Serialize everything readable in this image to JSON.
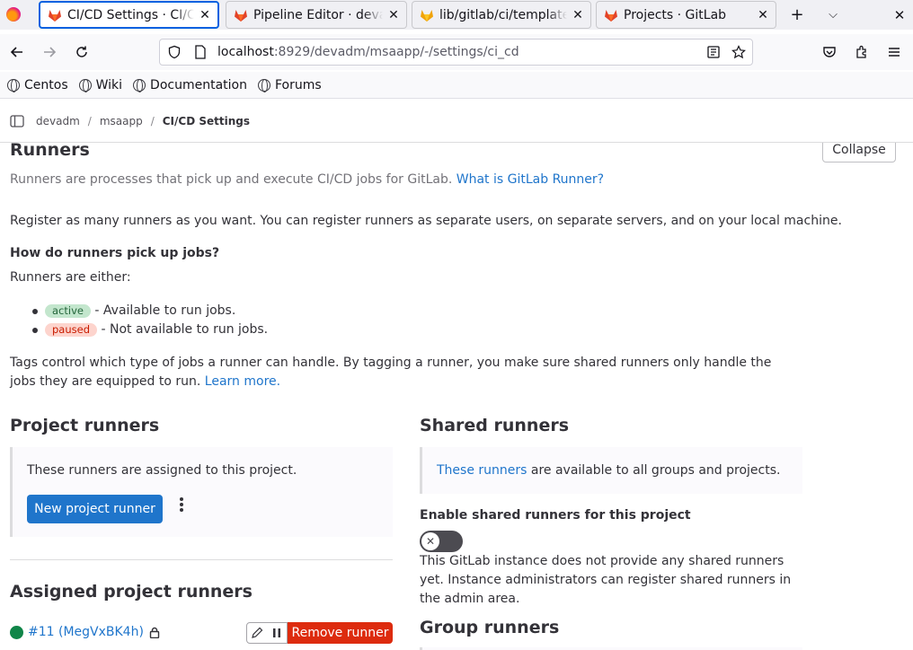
{
  "browser": {
    "tabs": [
      {
        "title": "CI/CD Settings · CI/CD",
        "active": true
      },
      {
        "title": "Pipeline Editor · devadm",
        "active": false
      },
      {
        "title": "lib/gitlab/ci/templates/",
        "active": false
      },
      {
        "title": "Projects · GitLab",
        "active": false
      }
    ],
    "url_host": "localhost",
    "url_path": ":8929/devadm/msaapp/-/settings/ci_cd",
    "bookmarks": [
      "Centos",
      "Wiki",
      "Documentation",
      "Forums"
    ]
  },
  "breadcrumb": {
    "items": [
      "devadm",
      "msaapp"
    ],
    "current": "CI/CD Settings"
  },
  "runners": {
    "title": "Runners",
    "collapse_label": "Collapse",
    "intro": "Runners are processes that pick up and execute CI/CD jobs for GitLab.",
    "intro_link": "What is GitLab Runner?",
    "register_text": "Register as many runners as you want. You can register runners as separate users, on separate servers, and on your local machine.",
    "how_heading": "How do runners pick up jobs?",
    "either_text": "Runners are either:",
    "active_badge": "active",
    "active_desc": " - Available to run jobs.",
    "paused_badge": "paused",
    "paused_desc": " - Not available to run jobs.",
    "tags_text": "Tags control which type of jobs a runner can handle. By tagging a runner, you make sure shared runners only handle the jobs they are equipped to run.",
    "tags_link": "Learn more."
  },
  "project_runners": {
    "title": "Project runners",
    "assigned_text": "These runners are assigned to this project.",
    "new_button": "New project runner"
  },
  "assigned_runners": {
    "title": "Assigned project runners",
    "runner_label": "#11 (MegVxBK4h)",
    "remove_button": "Remove runner"
  },
  "shared_runners": {
    "title": "Shared runners",
    "info_link": "These runners",
    "info_text": " are available to all groups and projects.",
    "enable_label": "Enable shared runners for this project",
    "toggle_on": false,
    "none_text": "This GitLab instance does not provide any shared runners yet. Instance administrators can register shared runners in the admin area."
  },
  "group_runners": {
    "title": "Group runners"
  },
  "colors": {
    "accent": "#1f75cb",
    "tab_focus": "#0061e0",
    "danger": "#dd2b0e",
    "online": "#108548",
    "active_badge_bg": "#c3e6cd",
    "paused_badge_bg": "#fdd4cd"
  }
}
